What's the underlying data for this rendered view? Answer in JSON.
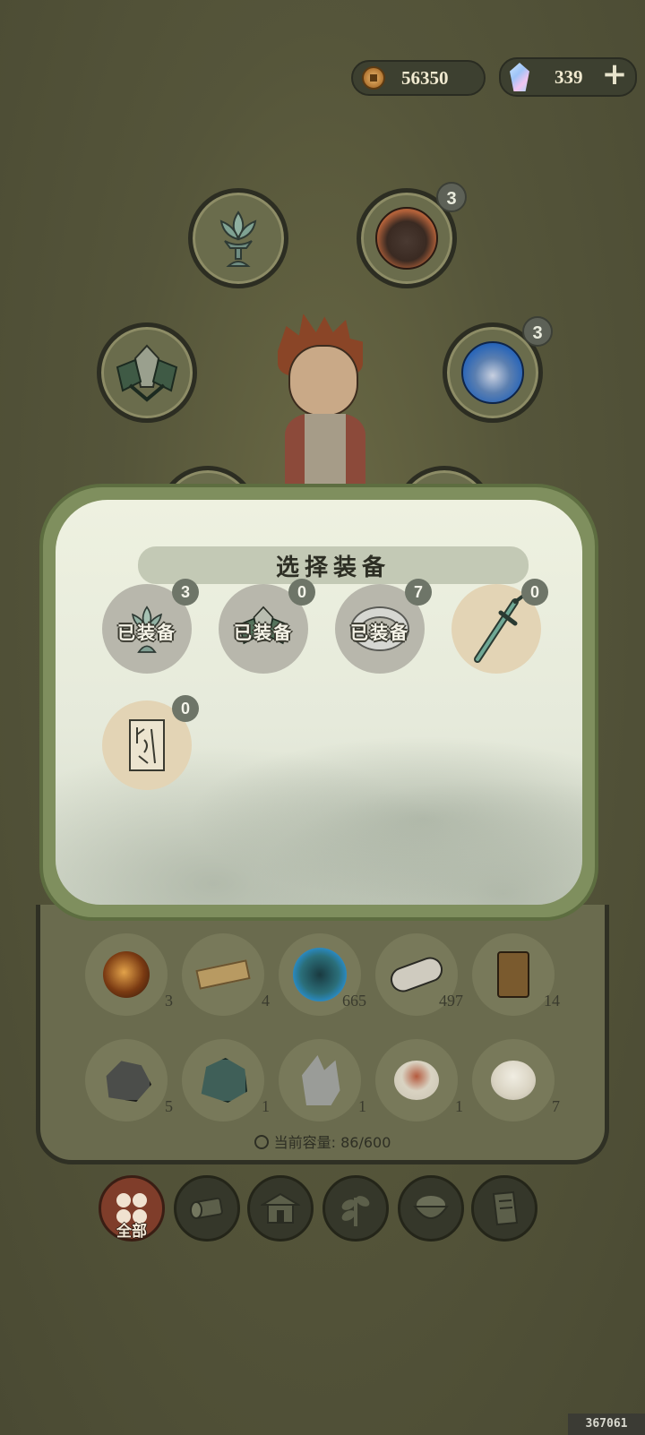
{
  "currency": {
    "coins": "56350",
    "gems": "339",
    "add_label": "+"
  },
  "slots": [
    {
      "name": "lotus-lamp",
      "badge": ""
    },
    {
      "name": "monster-portrait",
      "badge": "3"
    },
    {
      "name": "leaf-armor",
      "badge": ""
    },
    {
      "name": "blue-spirit",
      "badge": "3"
    }
  ],
  "modal": {
    "title": "选择装备",
    "equipped_label": "已装备",
    "items": [
      {
        "name": "lotus-lamp",
        "count": "3",
        "equipped": true
      },
      {
        "name": "leaf-armor",
        "count": "0",
        "equipped": true
      },
      {
        "name": "silver-ring",
        "count": "7",
        "equipped": true
      },
      {
        "name": "jade-sword",
        "count": "0",
        "equipped": false
      },
      {
        "name": "talisman-scroll",
        "count": "0",
        "equipped": false
      }
    ]
  },
  "inventory": {
    "row1": [
      "3",
      "4",
      "665",
      "497",
      "14"
    ],
    "row2": [
      "5",
      "1",
      "1",
      "1",
      "7"
    ],
    "capacity_label": "当前容量: 86/600"
  },
  "tabs": {
    "all_label": "全部"
  },
  "build_id": "367061"
}
